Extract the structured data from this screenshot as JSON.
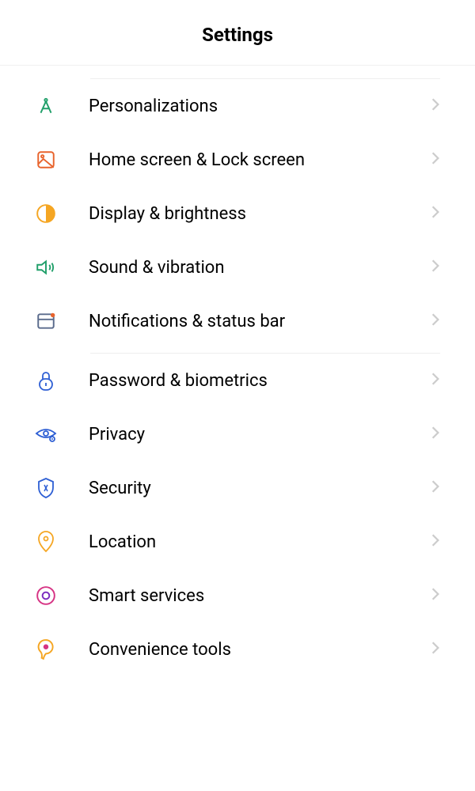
{
  "header": {
    "title": "Settings"
  },
  "groups": [
    {
      "items": [
        {
          "icon": "compass-icon",
          "label": "Personalizations"
        },
        {
          "icon": "home-lock-icon",
          "label": "Home screen & Lock screen"
        },
        {
          "icon": "brightness-icon",
          "label": "Display & brightness"
        },
        {
          "icon": "sound-icon",
          "label": "Sound & vibration"
        },
        {
          "icon": "notification-icon",
          "label": "Notifications & status bar"
        }
      ]
    },
    {
      "items": [
        {
          "icon": "lock-icon",
          "label": "Password & biometrics"
        },
        {
          "icon": "privacy-icon",
          "label": "Privacy"
        },
        {
          "icon": "security-icon",
          "label": "Security"
        },
        {
          "icon": "location-icon",
          "label": "Location"
        },
        {
          "icon": "smart-services-icon",
          "label": "Smart services"
        },
        {
          "icon": "convenience-icon",
          "label": "Convenience tools"
        }
      ]
    }
  ]
}
